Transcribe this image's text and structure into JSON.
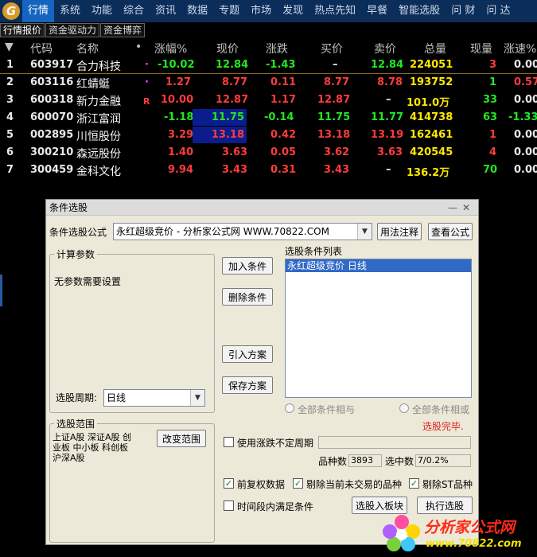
{
  "logo_text": "G",
  "menu": [
    "行情",
    "系统",
    "功能",
    "综合",
    "资讯",
    "数据",
    "专题",
    "市场",
    "发现",
    "热点先知",
    "早餐",
    "智能选股",
    "问 财",
    "问 达"
  ],
  "sub_tabs": [
    "行情报价",
    "资金驱动力",
    "资金博弈"
  ],
  "table": {
    "headers": [
      "代码",
      "名称",
      "•",
      "涨幅%",
      "现价",
      "涨跌",
      "买价",
      "卖价",
      "总量",
      "现量",
      "涨速%"
    ],
    "rows": [
      {
        "idx": "1",
        "code": "603917",
        "name": "合力科技",
        "flag": "·",
        "pct": "-10.02",
        "price": "12.84",
        "change": "-1.43",
        "bid": "–",
        "ask": "12.84",
        "vol": "224051",
        "cur": "3",
        "speed": "0.00"
      },
      {
        "idx": "2",
        "code": "603116",
        "name": "红蜻蜓",
        "flag": "·",
        "pct": "1.27",
        "price": "8.77",
        "change": "0.11",
        "bid": "8.77",
        "ask": "8.78",
        "vol": "193752",
        "cur": "1",
        "speed": "0.57"
      },
      {
        "idx": "3",
        "code": "600318",
        "name": "新力金融",
        "flag": "R",
        "pct": "10.00",
        "price": "12.87",
        "change": "1.17",
        "bid": "12.87",
        "ask": "–",
        "vol": "101.0万",
        "cur": "33",
        "speed": "0.00"
      },
      {
        "idx": "4",
        "code": "600070",
        "name": "浙江富润",
        "flag": "",
        "pct": "-1.18",
        "price": "11.75",
        "change": "-0.14",
        "bid": "11.75",
        "ask": "11.77",
        "vol": "414738",
        "cur": "63",
        "speed": "-1.33"
      },
      {
        "idx": "5",
        "code": "002895",
        "name": "川恒股份",
        "flag": "",
        "pct": "3.29",
        "price": "13.18",
        "change": "0.42",
        "bid": "13.18",
        "ask": "13.19",
        "vol": "162461",
        "cur": "1",
        "speed": "0.00"
      },
      {
        "idx": "6",
        "code": "300210",
        "name": "森远股份",
        "flag": "",
        "pct": "1.40",
        "price": "3.63",
        "change": "0.05",
        "bid": "3.62",
        "ask": "3.63",
        "vol": "420545",
        "cur": "4",
        "speed": "0.00"
      },
      {
        "idx": "7",
        "code": "300459",
        "name": "金科文化",
        "flag": "",
        "pct": "9.94",
        "price": "3.43",
        "change": "0.31",
        "bid": "3.43",
        "ask": "–",
        "vol": "136.2万",
        "cur": "70",
        "speed": "0.00"
      }
    ]
  },
  "dialog": {
    "title": "条件选股",
    "window_controls": "—✕",
    "formula_label": "条件选股公式",
    "formula_value": "永红超级竞价 - 分析家公式网 WWW.70822.COM",
    "usage_button": "用法注释",
    "view_formula_button": "查看公式",
    "calc_params_title": "计算参数",
    "no_params_text": "无参数需要设置",
    "add_condition_button": "加入条件",
    "delete_condition_button": "删除条件",
    "import_plan_button": "引入方案",
    "save_plan_button": "保存方案",
    "condition_list_label": "选股条件列表",
    "condition_items": [
      "永红超级竞价   日线"
    ],
    "period_label": "选股周期:",
    "period_value": "日线",
    "radio_and": "全部条件相与",
    "radio_or": "全部条件相或",
    "status": "选股完毕.",
    "range_title": "选股范围",
    "range_text_lines": [
      "上证A股 深证A股 创",
      "业板 中小板 科创板",
      "沪深A股"
    ],
    "change_range_button": "改变范围",
    "use_period_label": "使用涨跌不定周期",
    "count_label": "品种数",
    "count_value": "3893",
    "selected_label": "选中数",
    "selected_value": "7/0.2%",
    "adjust_label": "前复权数据",
    "exclude_untraded_label": "剔除当前未交易的品种",
    "exclude_st_label": "剔除ST品种",
    "time_range_label": "时间段内满足条件",
    "to_block_button": "选股入板块",
    "execute_button": "执行选股"
  },
  "watermark": {
    "text": "分析家公式网",
    "url": "www.70822.com"
  },
  "colors": {
    "up": "#ff3b3b",
    "down": "#22e622",
    "menu_bg": "#0a2d5a",
    "menu_active": "#1565c0",
    "highlight": "#0b1c8c",
    "dialog_bg": "#ece9d8",
    "selection": "#3169c6"
  }
}
